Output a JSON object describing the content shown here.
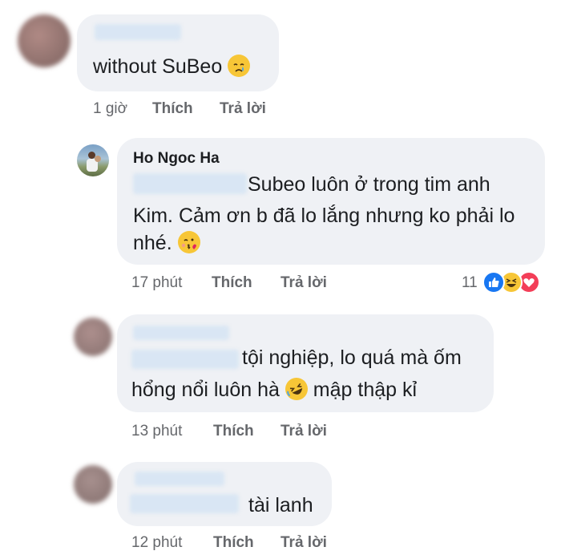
{
  "comments": [
    {
      "text": "without SuBeo",
      "time": "1 giờ",
      "like_label": "Thích",
      "reply_label": "Trả lời",
      "emoji": "crying-face"
    },
    {
      "author": "Ho Ngoc Ha",
      "text_line1": "Subeo luôn ở trong tim anh",
      "text_line2": "Kim. Cảm ơn b đã lo lắng nhưng ko phải lo",
      "text_line3": "nhé.",
      "time": "17 phút",
      "like_label": "Thích",
      "reply_label": "Trả lời",
      "reaction_count": "11",
      "reactions": [
        "like-icon",
        "haha-icon",
        "love-icon"
      ],
      "emoji": "kissing-heart-face"
    },
    {
      "text_line1": "tội nghiệp, lo quá mà ốm",
      "text_line2a": "hổng nổi luôn hà",
      "text_line2b": "mập thập kỉ",
      "time": "13 phút",
      "like_label": "Thích",
      "reply_label": "Trả lời",
      "emoji": "rolling-laughing-face"
    },
    {
      "text": "tài lanh",
      "time": "12 phút",
      "like_label": "Thích",
      "reply_label": "Trả lời"
    }
  ],
  "colors": {
    "bubble": "#eff1f5",
    "meta": "#65676b",
    "like_blue": "#1877f2",
    "love_red": "#f33e58",
    "haha_yellow": "#f7c637"
  }
}
